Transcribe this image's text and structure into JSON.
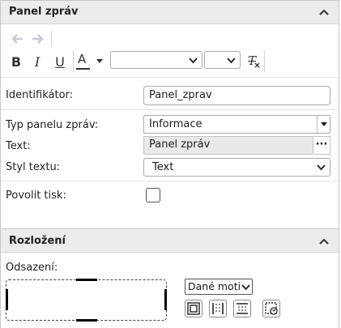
{
  "panel_section": {
    "title": "Panel zpráv",
    "toolbar": {
      "undo_icon": "arrow-left-icon",
      "redo_icon": "arrow-right-icon",
      "bold_label": "B",
      "italic_label": "I",
      "underline_label": "U",
      "font_color_label": "A",
      "font_color_accent": "#d9534f",
      "font_family_value": "",
      "font_size_value": "",
      "clear_format_label": "T"
    },
    "fields": {
      "identifier_label": "Identifikátor:",
      "identifier_value": "Panel_zprav",
      "type_label": "Typ panelu zpráv:",
      "type_value": "Informace",
      "text_label": "Text:",
      "text_value": "Panel zpráv",
      "text_more": "···",
      "style_label": "Styl textu:",
      "style_value": "Text",
      "print_label": "Povolit tisk:",
      "print_checked": false
    }
  },
  "layout_section": {
    "title": "Rozložení",
    "padding_label": "Odsazení:",
    "padding_mode_value": "Dané motiv"
  }
}
